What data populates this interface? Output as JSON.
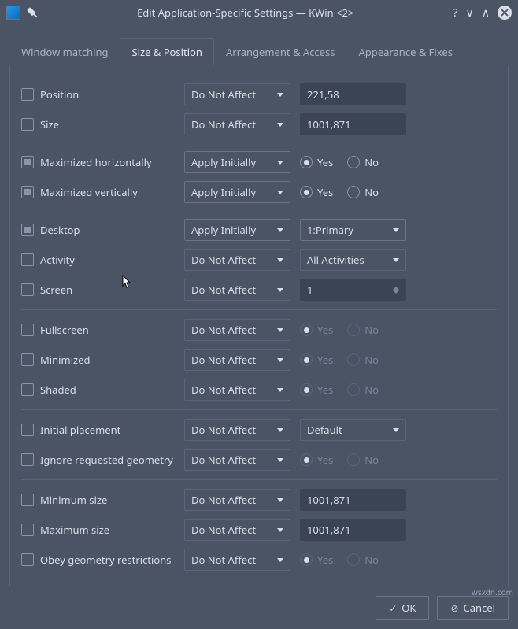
{
  "titlebar": {
    "title": "Edit Application-Specific Settings — KWin <2>"
  },
  "tabs": {
    "t0": "Window matching",
    "t1": "Size & Position",
    "t2": "Arrangement & Access",
    "t3": "Appearance & Fixes"
  },
  "rows": {
    "position": {
      "label": "Position",
      "rule": "Do Not Affect",
      "val": "221,58"
    },
    "size": {
      "label": "Size",
      "rule": "Do Not Affect",
      "val": "1001,871"
    },
    "maxh": {
      "label": "Maximized horizontally",
      "rule": "Apply Initially",
      "yes": "Yes",
      "no": "No"
    },
    "maxv": {
      "label": "Maximized vertically",
      "rule": "Apply Initially",
      "yes": "Yes",
      "no": "No"
    },
    "desktop": {
      "label": "Desktop",
      "rule": "Apply Initially",
      "val": "1:Primary"
    },
    "activity": {
      "label": "Activity",
      "rule": "Do Not Affect",
      "val": "All Activities"
    },
    "screen": {
      "label": "Screen",
      "rule": "Do Not Affect",
      "val": "1"
    },
    "fullscreen": {
      "label": "Fullscreen",
      "rule": "Do Not Affect",
      "yes": "Yes",
      "no": "No"
    },
    "minimized": {
      "label": "Minimized",
      "rule": "Do Not Affect",
      "yes": "Yes",
      "no": "No"
    },
    "shaded": {
      "label": "Shaded",
      "rule": "Do Not Affect",
      "yes": "Yes",
      "no": "No"
    },
    "placement": {
      "label": "Initial placement",
      "rule": "Do Not Affect",
      "val": "Default"
    },
    "ignore": {
      "label": "Ignore requested geometry",
      "rule": "Do Not Affect",
      "yes": "Yes",
      "no": "No"
    },
    "minsize": {
      "label": "Minimum size",
      "rule": "Do Not Affect",
      "val": "1001,871"
    },
    "maxsize": {
      "label": "Maximum size",
      "rule": "Do Not Affect",
      "val": "1001,871"
    },
    "obey": {
      "label": "Obey geometry restrictions",
      "rule": "Do Not Affect",
      "yes": "Yes",
      "no": "No"
    }
  },
  "buttons": {
    "ok": "OK",
    "cancel": "Cancel"
  },
  "watermark": "wsxdn.com"
}
